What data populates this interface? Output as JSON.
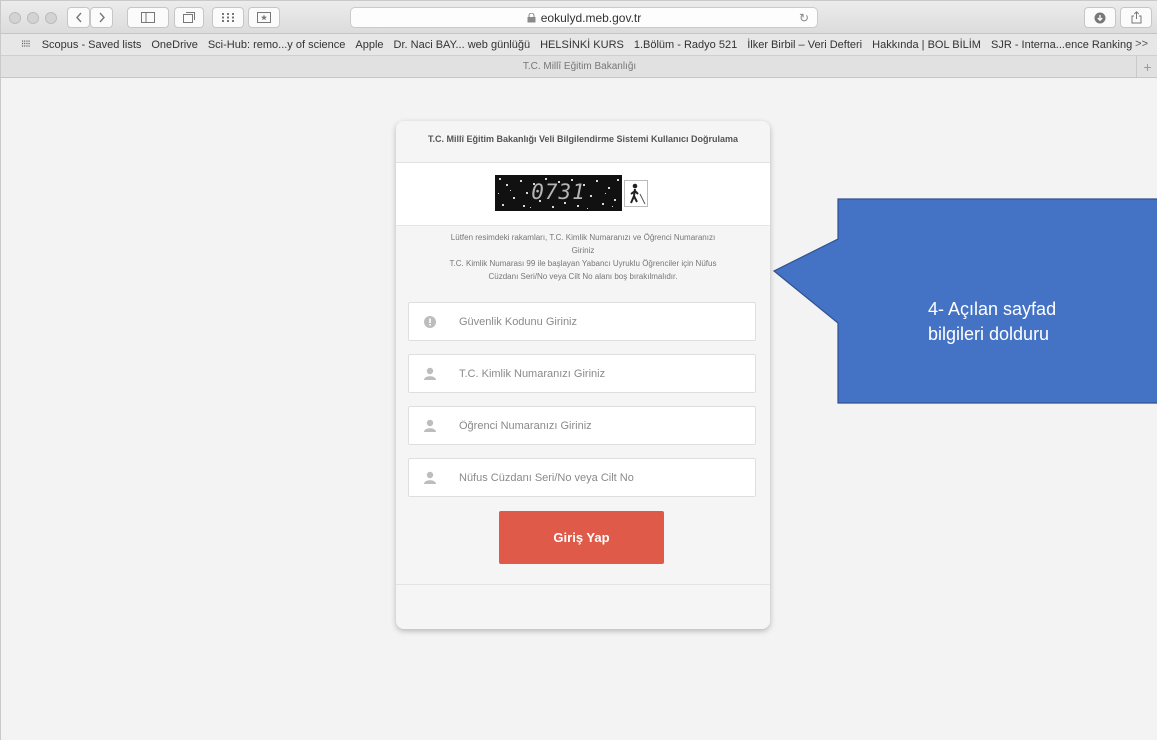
{
  "browser": {
    "url": "eokulyd.meb.gov.tr",
    "tab_title": "T.C. Millî Eğitim Bakanlığı",
    "bookmarks": [
      "Scopus - Saved lists",
      "OneDrive",
      "Sci-Hub: remo...y of science",
      "Apple",
      "Dr. Naci BAY... web günlüğü",
      "HELSİNKİ KURS",
      "1.Bölüm - Radyo 521",
      "İlker Birbil – Veri Defteri",
      "Hakkında | BOL BİLİM",
      "SJR - Interna...ence Ranking"
    ],
    "more_label": ">>",
    "new_tab_label": "+"
  },
  "form": {
    "title": "T.C. Millî Eğitim Bakanlığı  Veli Bilgilendirme Sistemi Kullanıcı Doğrulama",
    "captcha_text": "0731",
    "instructions_line1": "Lütfen resimdeki rakamları, T.C. Kimlik Numaranızı ve Öğrenci Numaranızı",
    "instructions_line2": "Giriniz",
    "instructions_line3": "T.C. Kimlik Numarası 99 ile başlayan Yabancı Uyruklu Öğrenciler için Nüfus",
    "instructions_line4": "Cüzdanı Seri/No veya Cilt No alanı boş bırakılmalıdır.",
    "fields": [
      {
        "placeholder": "Güvenlik Kodunu Giriniz",
        "icon": "exclamation-icon"
      },
      {
        "placeholder": "T.C. Kimlik Numaranızı Giriniz",
        "icon": "user-icon"
      },
      {
        "placeholder": "Öğrenci Numaranızı Giriniz",
        "icon": "user-icon"
      },
      {
        "placeholder": "Nüfus Cüzdanı Seri/No veya Cilt No",
        "icon": "user-icon"
      }
    ],
    "submit_label": "Giriş Yap"
  },
  "callout": {
    "line1": "4- Açılan sayfad",
    "line2": "bilgileri dolduru",
    "color": "#4472c4"
  },
  "colors": {
    "button": "#e05a49",
    "callout_border": "#2f528f"
  }
}
